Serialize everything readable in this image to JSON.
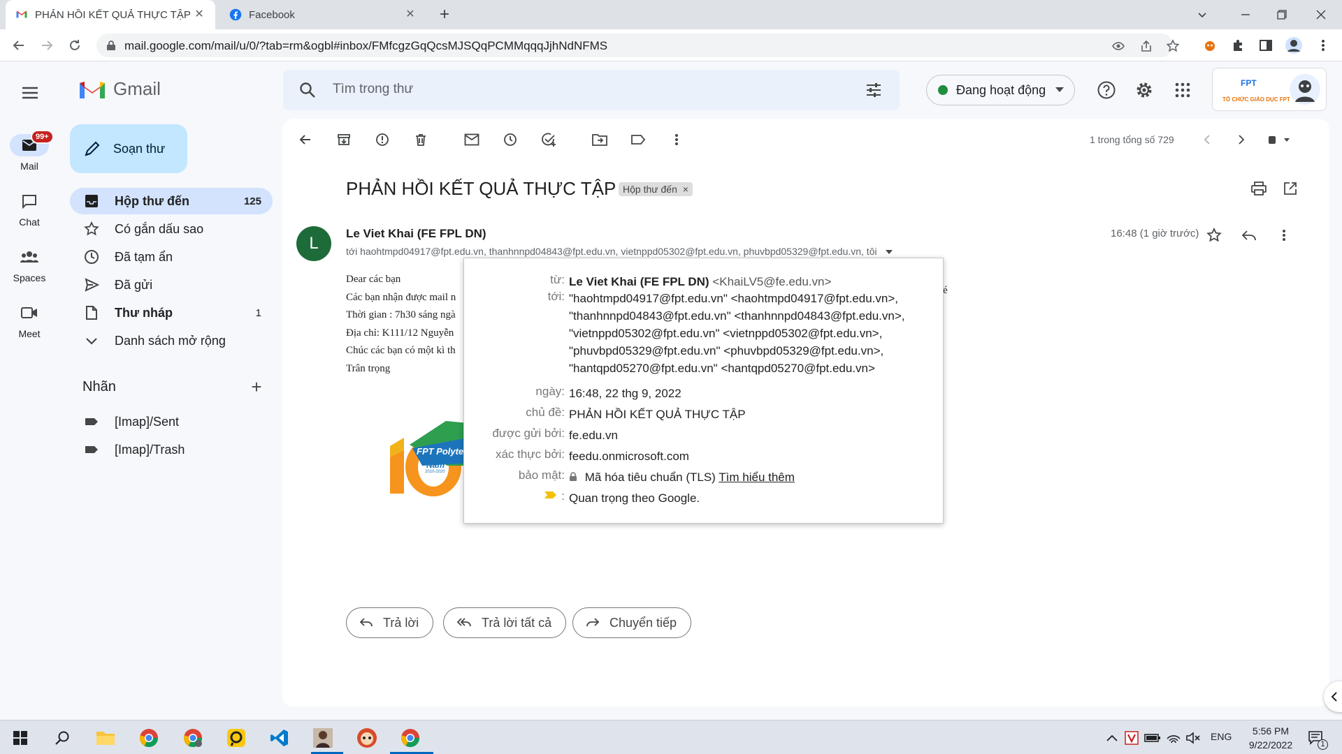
{
  "browser": {
    "tabs": [
      {
        "title": "PHẢN HỒI KẾT QUẢ THỰC TẬP -",
        "favicon": "gmail-favicon",
        "active": true
      },
      {
        "title": "Facebook",
        "favicon": "facebook-favicon",
        "active": false
      }
    ],
    "url": "mail.google.com/mail/u/0/?tab=rm&ogbl#inbox/FMfcgzGqQcsMJSQqPCMMqqqJjhNdNFMS"
  },
  "gmail": {
    "brand": "Gmail",
    "search_placeholder": "Tìm trong thư",
    "status": "Đang hoạt động",
    "org_badge_text": "TỔ CHỨC GIÁO DỤC FPT"
  },
  "rail": [
    {
      "label": "Mail",
      "icon": "mail-icon",
      "badge": "99+"
    },
    {
      "label": "Chat",
      "icon": "chat-icon"
    },
    {
      "label": "Spaces",
      "icon": "spaces-icon"
    },
    {
      "label": "Meet",
      "icon": "meet-icon"
    }
  ],
  "compose_label": "Soạn thư",
  "nav": [
    {
      "label": "Hộp thư đến",
      "count": "125",
      "icon": "inbox-icon"
    },
    {
      "label": "Có gắn dấu sao",
      "count": "",
      "icon": "star-icon"
    },
    {
      "label": "Đã tạm ẩn",
      "count": "",
      "icon": "clock-icon"
    },
    {
      "label": "Đã gửi",
      "count": "",
      "icon": "send-icon"
    },
    {
      "label": "Thư nháp",
      "count": "1",
      "icon": "draft-icon"
    },
    {
      "label": "Danh sách mở rộng",
      "count": "",
      "icon": "chevron-down-icon"
    }
  ],
  "labels": {
    "heading": "Nhãn",
    "items": [
      "[Imap]/Sent",
      "[Imap]/Trash"
    ]
  },
  "message": {
    "pager": "1 trong tổng số 729",
    "subject": "PHẢN HỒI KẾT QUẢ THỰC TẬP",
    "chip": "Hộp thư đến",
    "avatar_letter": "L",
    "sender": "Le Viet Khai (FE FPL DN)",
    "recipients": "tới haohtmpd04917@fpt.edu.vn, thanhnnpd04843@fpt.edu.vn, vietnppd05302@fpt.edu.vn, phuvbpd05329@fpt.edu.vn, tôi",
    "time": "16:48 (1 giờ trước)",
    "body_lines": [
      "Dear các bạn",
      "Các bạn nhận được mail n",
      "Thời gian : 7h30 sáng ngà",
      "Địa chỉ: K111/12 Nguyễn",
      "Chúc các bạn có một kì th",
      "Trân trọng"
    ],
    "body_overflow": "é",
    "logo_texts": {
      "brand": "FPT Polytec",
      "year": "Năm",
      "range": "2010-2020"
    }
  },
  "details": {
    "from_label": "từ:",
    "from_name": "Le Viet Khai (FE FPL DN)",
    "from_email": "<KhaiLV5@fe.edu.vn>",
    "to_label": "tới:",
    "to_lines": [
      "\"haohtmpd04917@fpt.edu.vn\" <haohtmpd04917@fpt.edu.vn>,",
      "\"thanhnnpd04843@fpt.edu.vn\" <thanhnnpd04843@fpt.edu.vn>,",
      "\"vietnppd05302@fpt.edu.vn\" <vietnppd05302@fpt.edu.vn>,",
      "\"phuvbpd05329@fpt.edu.vn\" <phuvbpd05329@fpt.edu.vn>,",
      "\"hantqpd05270@fpt.edu.vn\" <hantqpd05270@fpt.edu.vn>"
    ],
    "date_label": "ngày:",
    "date": "16:48, 22 thg 9, 2022",
    "subject_label": "chủ đề:",
    "subject": "PHẢN HỒI KẾT QUẢ THỰC TẬP",
    "mailed_by_label": "được gửi bởi:",
    "mailed_by": "fe.edu.vn",
    "signed_by_label": "xác thực bởi:",
    "signed_by": "feedu.onmicrosoft.com",
    "security_label": "bảo mật:",
    "security": "Mã hóa tiêu chuẩn (TLS)",
    "learn_more": "Tìm hiểu thêm",
    "importance": "Quan trọng theo Google."
  },
  "replies": {
    "reply": "Trả lời",
    "reply_all": "Trả lời tất cả",
    "forward": "Chuyển tiếp"
  },
  "taskbar": {
    "lang": "ENG",
    "time": "5:56 PM",
    "date": "9/22/2022",
    "notif_count": "1"
  },
  "colors": {
    "accent": "#0b57d0",
    "nav_active": "#d3e3fd",
    "compose": "#c2e7ff",
    "avatar": "#1e6b3a",
    "badge": "#c5221f"
  }
}
